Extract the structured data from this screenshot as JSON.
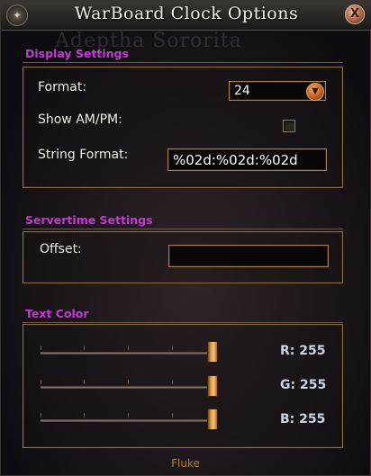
{
  "window": {
    "title": "WarBoard Clock Options",
    "close_glyph": "X"
  },
  "background": {
    "watermark_title": "Adeptha Sororita",
    "watermark_sub": ""
  },
  "display_settings": {
    "label": "Display Settings",
    "format_label": "Format:",
    "format_value": "24",
    "show_ampm_label": "Show AM/PM:",
    "show_ampm_checked": false,
    "string_format_label": "String Format:",
    "string_format_value": "%02d:%02d:%02d"
  },
  "servertime_settings": {
    "label": "Servertime Settings",
    "offset_label": "Offset:",
    "offset_value": ""
  },
  "text_color": {
    "label": "Text Color",
    "sliders": [
      {
        "channel": "R",
        "value": 255,
        "max": 255,
        "display": "R: 255"
      },
      {
        "channel": "G",
        "value": 255,
        "max": 255,
        "display": "G: 255"
      },
      {
        "channel": "B",
        "value": 255,
        "max": 255,
        "display": "B: 255"
      }
    ]
  },
  "footer": {
    "text": "Fluke"
  },
  "icons": {
    "corner_left": "ornament-icon",
    "close": "close-icon",
    "dropdown": "chevron-down-icon"
  }
}
